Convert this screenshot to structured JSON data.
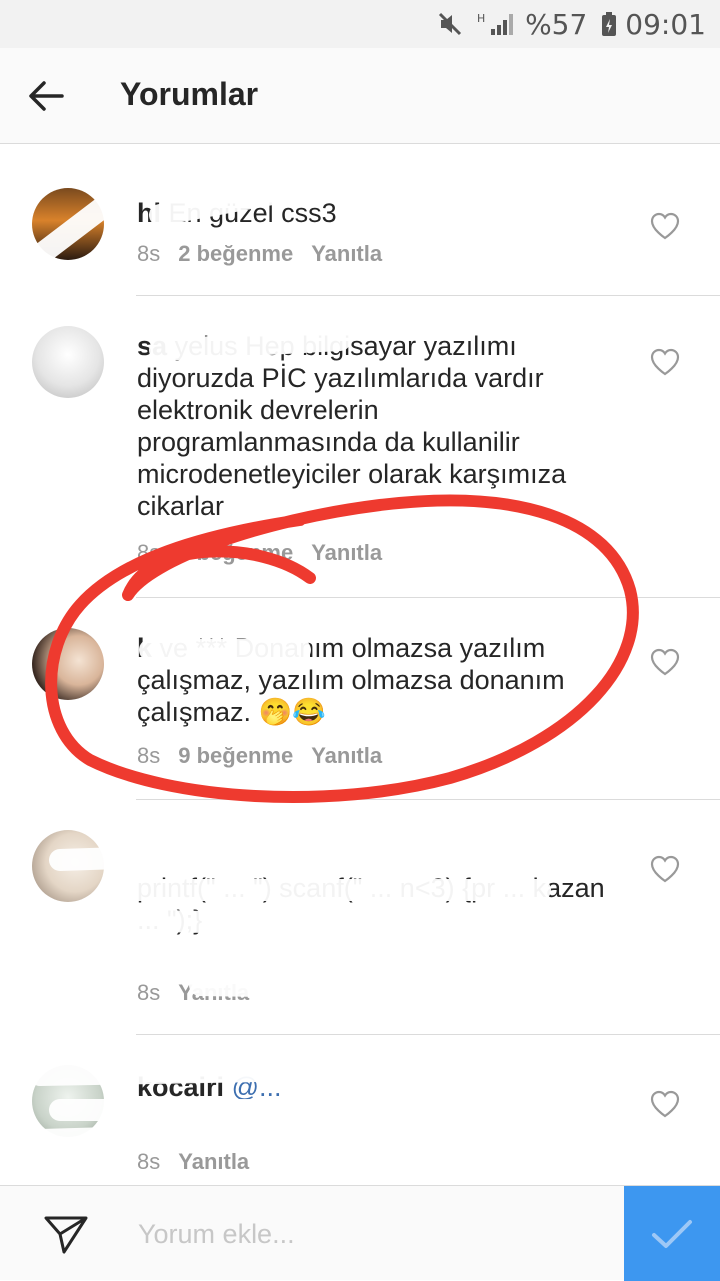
{
  "status_bar": {
    "battery": "%57",
    "time": "09:01"
  },
  "header": {
    "title": "Yorumlar"
  },
  "comments": [
    {
      "user": "hl",
      "text": "En güzel css3",
      "time": "8s",
      "likes": "2 beğenme",
      "reply": "Yanıtla"
    },
    {
      "user": "sa",
      "text": "yelus Hep bilgisayar yazılımı diyoruzda PİC yazılımlarıda vardır elektronik devrelerin programlanmasında da kullanilir microdenetleyiciler olarak karşımıza cikarlar",
      "time": "8s",
      "likes": "2 beğenme",
      "reply": "Yanıtla"
    },
    {
      "user": "k",
      "text": "ve *** Donanım olmazsa yazılım çalışmaz, yazılım olmazsa donanım çalışmaz. 🤭😂",
      "time": "8s",
      "likes": "9 beğenme",
      "reply": "Yanıtla"
    },
    {
      "user": "",
      "text": "printf(\" ... \") scanf(\" ... n<3) {pr ... kazan ... \");}",
      "time": "8s",
      "likes": "",
      "reply": "Yanıtla"
    },
    {
      "user": "kocairi",
      "text": "@...",
      "time": "8s",
      "likes": "",
      "reply": "Yanıtla"
    }
  ],
  "composer": {
    "placeholder": "Yorum ekle..."
  },
  "icons": {
    "mute": "mute-icon",
    "signal": "signal-icon",
    "battery": "battery-icon",
    "back": "arrow-left-icon",
    "like": "heart-outline-icon",
    "send": "paper-plane-icon",
    "post": "checkmark-icon"
  },
  "colors": {
    "accent": "#3d97f0",
    "annotation": "#ee3a2f",
    "meta": "#999999"
  }
}
